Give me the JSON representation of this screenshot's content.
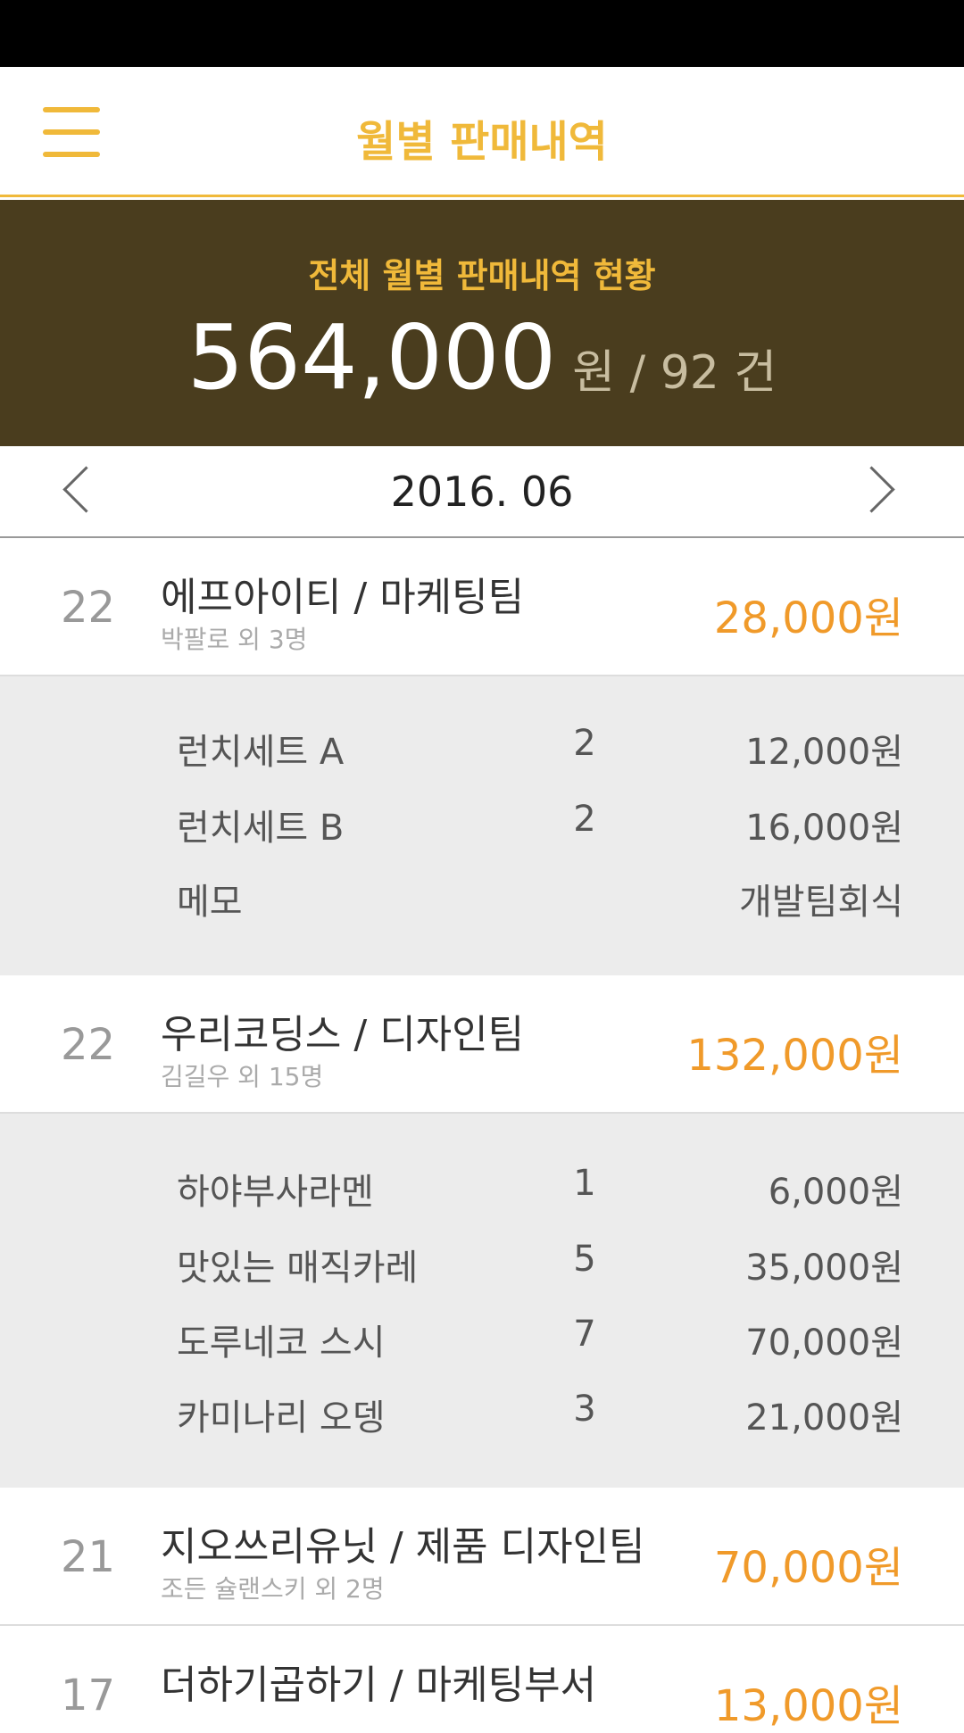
{
  "header": {
    "title": "월별 판매내역"
  },
  "summary": {
    "label": "전체 월별 판매내역 현황",
    "amount": "564,000",
    "unit_text": "원 / 92 건"
  },
  "month_nav": {
    "current": "2016. 06"
  },
  "orders": [
    {
      "day": "22",
      "company": "에프아이티 / 마케팅팀",
      "members": "박팔로 외 3명",
      "total": "28,000원",
      "items": [
        {
          "name": "런치세트 A",
          "qty": "2",
          "price": "12,000원"
        },
        {
          "name": "런치세트 B",
          "qty": "2",
          "price": "16,000원"
        },
        {
          "name": "메모",
          "qty": "",
          "price": "개발팀회식"
        }
      ]
    },
    {
      "day": "22",
      "company": "우리코딩스 / 디자인팀",
      "members": "김길우 외 15명",
      "total": "132,000원",
      "items": [
        {
          "name": "하야부사라멘",
          "qty": "1",
          "price": "6,000원"
        },
        {
          "name": "맛있는 매직카레",
          "qty": "5",
          "price": "35,000원"
        },
        {
          "name": "도루네코 스시",
          "qty": "7",
          "price": "70,000원"
        },
        {
          "name": "카미나리 오뎅",
          "qty": "3",
          "price": "21,000원"
        }
      ]
    },
    {
      "day": "21",
      "company": "지오쓰리유닛 / 제품 디자인팀",
      "members": "조든 슐랜스키 외 2명",
      "total": "70,000원"
    },
    {
      "day": "17",
      "company": "더하기곱하기 / 마케팅부서",
      "members": "",
      "total": "13,000원"
    }
  ],
  "colors": {
    "accent": "#f0b93a",
    "summary_bg": "#4a3d1e",
    "price": "#f09a2a",
    "detail_bg": "#ececec"
  },
  "icons": {
    "menu": "hamburger-menu-icon",
    "prev": "chevron-left-icon",
    "next": "chevron-right-icon"
  }
}
